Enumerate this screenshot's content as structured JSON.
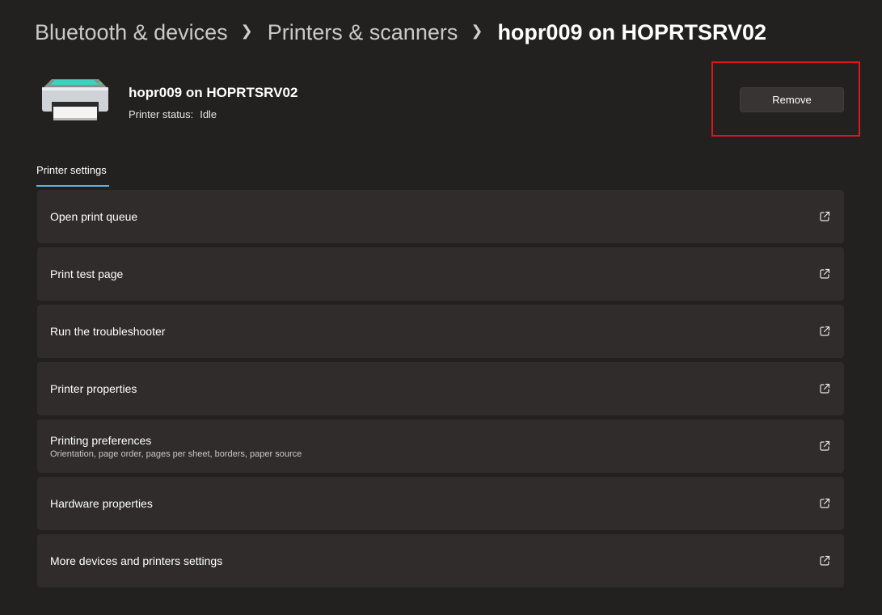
{
  "breadcrumb": {
    "items": [
      "Bluetooth & devices",
      "Printers & scanners"
    ],
    "current": "hopr009 on HOPRTSRV02"
  },
  "printer": {
    "name": "hopr009 on HOPRTSRV02",
    "status_label": "Printer status:",
    "status_value": "Idle",
    "icon": "printer-icon"
  },
  "actions": {
    "remove_label": "Remove"
  },
  "tabs": {
    "settings_label": "Printer settings"
  },
  "settings": [
    {
      "label": "Open print queue",
      "icon": "open-external-icon"
    },
    {
      "label": "Print test page",
      "icon": "open-external-icon"
    },
    {
      "label": "Run the troubleshooter",
      "icon": "open-external-icon"
    },
    {
      "label": "Printer properties",
      "icon": "open-external-icon"
    },
    {
      "label": "Printing preferences",
      "sublabel": "Orientation, page order, pages per sheet, borders, paper source",
      "icon": "open-external-icon"
    },
    {
      "label": "Hardware properties",
      "icon": "open-external-icon"
    },
    {
      "label": "More devices and printers settings",
      "icon": "open-external-icon"
    }
  ],
  "colors": {
    "background": "#232020",
    "card": "#2f2c2b",
    "accent": "#62b3e4",
    "highlight": "#e0161b"
  }
}
